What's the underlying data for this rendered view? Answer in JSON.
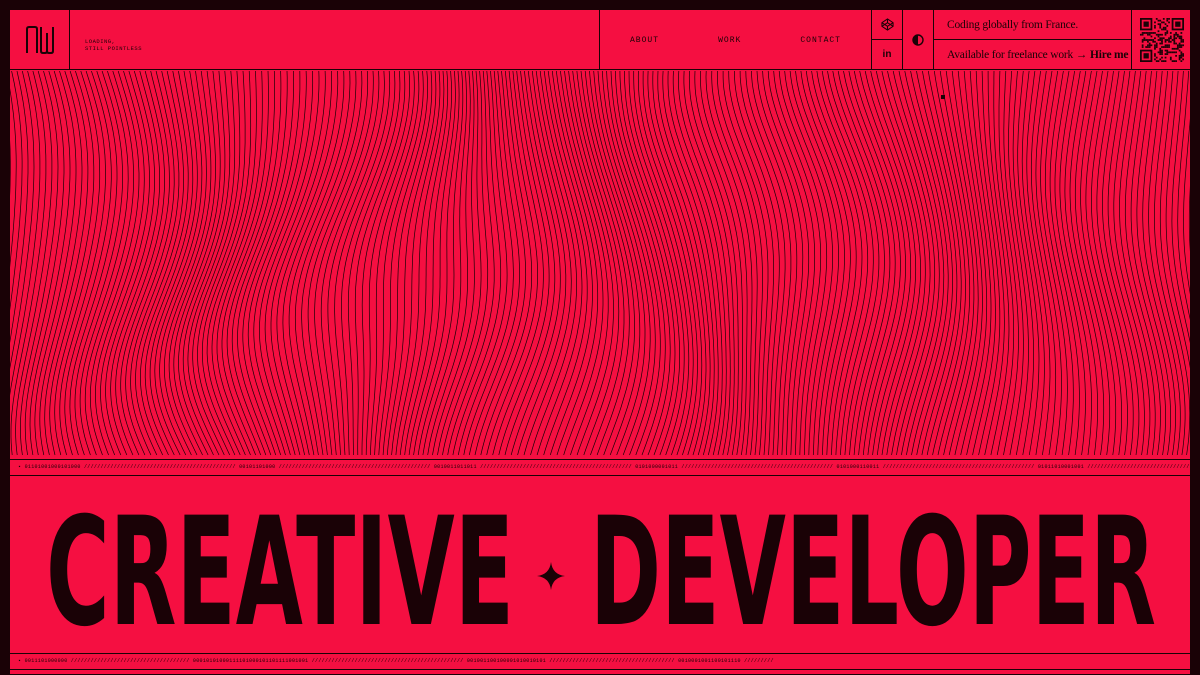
{
  "header": {
    "logo": "NW",
    "loading_text": "LOADING,\nSTILL POINTLESS",
    "nav": {
      "about": "ABOUT",
      "work": "WORK",
      "contact": "CONTACT"
    },
    "icons": {
      "codepen": "codepen-icon",
      "linkedin": "in",
      "theme": "contrast-icon"
    },
    "location_text": "Coding globally from France.",
    "availability_text": "Available for freelance work →",
    "hire_label": "Hire me",
    "qr": "qr-code-icon"
  },
  "ticker_top": "▪ 01101001000101000 ////////////////////////////////////////////// 00101101000 ////////////////////////////////////////////// 0010011011011 ////////////////////////////////////////////// 0101000001011 ////////////////////////////////////////////// 0101000110011 ////////////////////////////////////////////// 01011010001001 ////////////////////////////////",
  "ticker_bottom": "▪ 0011101000000 //////////////////////////////////// 00010101000111101000101101111001001 ////////////////////////////////////////////// 001001100100001010010101 ////////////////////////////////////// 0010001001100101110 /////////",
  "hero": {
    "word_left": "CREATIVE",
    "word_right": "DEVELOPER",
    "separator": "sparkle-icon"
  },
  "colors": {
    "background": "#f50f41",
    "ink": "#1a0206"
  }
}
